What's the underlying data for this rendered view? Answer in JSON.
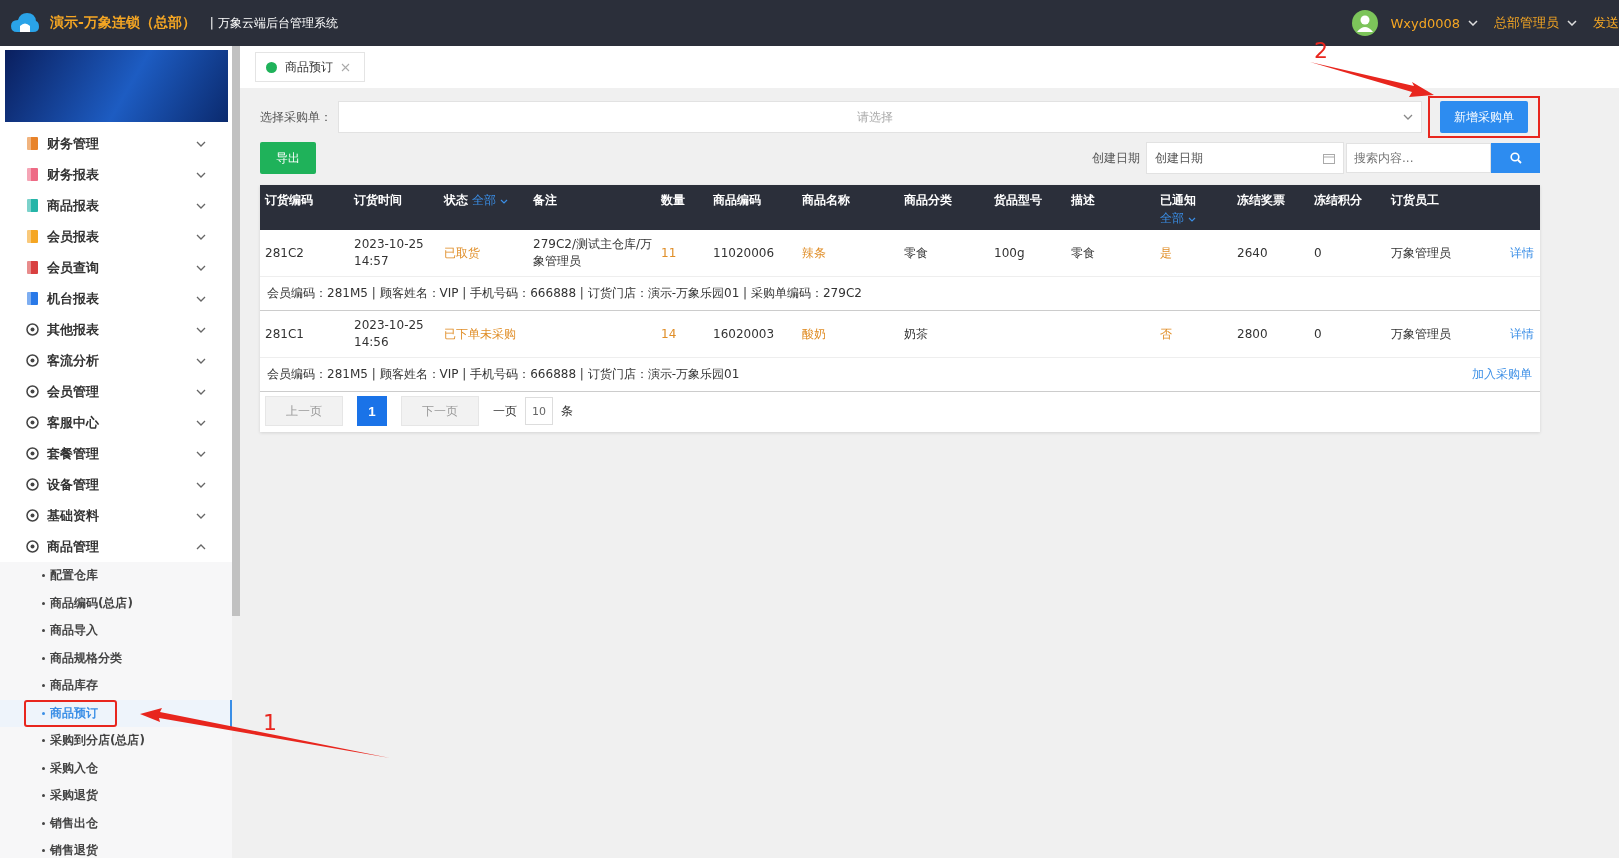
{
  "header": {
    "brand": "演示-万象连锁（总部）",
    "system_title": "| 万象云端后台管理系统",
    "user": "Wxyd0008",
    "role": "总部管理员",
    "extra": "发送"
  },
  "sidebar": {
    "items": [
      {
        "label": "财务管理",
        "expanded": false
      },
      {
        "label": "财务报表",
        "expanded": false
      },
      {
        "label": "商品报表",
        "expanded": false
      },
      {
        "label": "会员报表",
        "expanded": false
      },
      {
        "label": "会员查询",
        "expanded": false
      },
      {
        "label": "机台报表",
        "expanded": false
      },
      {
        "label": "其他报表",
        "expanded": false
      },
      {
        "label": "客流分析",
        "expanded": false
      },
      {
        "label": "会员管理",
        "expanded": false
      },
      {
        "label": "客服中心",
        "expanded": false
      },
      {
        "label": "套餐管理",
        "expanded": false
      },
      {
        "label": "设备管理",
        "expanded": false
      },
      {
        "label": "基础资料",
        "expanded": false
      },
      {
        "label": "商品管理",
        "expanded": true,
        "children": [
          {
            "label": "配置仓库",
            "selected": false,
            "highlighted": false
          },
          {
            "label": "商品编码(总店)",
            "selected": false,
            "highlighted": false
          },
          {
            "label": "商品导入",
            "selected": false,
            "highlighted": false
          },
          {
            "label": "商品规格分类",
            "selected": false,
            "highlighted": false
          },
          {
            "label": "商品库存",
            "selected": false,
            "highlighted": false
          },
          {
            "label": "商品预订",
            "selected": true,
            "highlighted": true
          },
          {
            "label": "采购到分店(总店)",
            "selected": false,
            "highlighted": false
          },
          {
            "label": "采购入仓",
            "selected": false,
            "highlighted": false
          },
          {
            "label": "采购退货",
            "selected": false,
            "highlighted": false
          },
          {
            "label": "销售出仓",
            "selected": false,
            "highlighted": false
          },
          {
            "label": "销售退货",
            "selected": false,
            "highlighted": false
          }
        ]
      }
    ]
  },
  "tabs": [
    {
      "label": "商品预订",
      "selected": true
    }
  ],
  "filters": {
    "order_label": "选择采购单：",
    "order_placeholder": "请选择",
    "new_button": {
      "label": "新增采购单",
      "highlighted": true
    },
    "export_button": "导出",
    "date_label": "创建日期",
    "date_placeholder": "创建日期",
    "search_placeholder": "搜索内容..."
  },
  "table": {
    "columns": [
      {
        "label": "订货编码"
      },
      {
        "label": "订货时间"
      },
      {
        "label": "状态",
        "filter": "全部"
      },
      {
        "label": "备注"
      },
      {
        "label": "数量"
      },
      {
        "label": "商品编码"
      },
      {
        "label": "商品名称"
      },
      {
        "label": "商品分类"
      },
      {
        "label": "货品型号"
      },
      {
        "label": "描述"
      },
      {
        "label": "已通知",
        "filter": "全部"
      },
      {
        "label": "冻结奖票"
      },
      {
        "label": "冻结积分"
      },
      {
        "label": "订货员工"
      }
    ],
    "rows": [
      {
        "cells": [
          "281C2",
          "2023-10-25 14:57",
          "已取货",
          "279C2/测试主仓库/万象管理员",
          "11",
          "11020006",
          "辣条",
          "零食",
          "100g",
          "零食",
          "是",
          "2640",
          "0",
          "万象管理员"
        ],
        "action": "详情",
        "info": "会员编码：281M5 | 顾客姓名：VIP | 手机号码：666888 | 订货门店：演示-万象乐园01 | 采购单编码：279C2"
      },
      {
        "cells": [
          "281C1",
          "2023-10-25 14:56",
          "已下单未采购",
          "",
          "14",
          "16020003",
          "酸奶",
          "奶茶",
          "",
          "",
          "否",
          "2800",
          "0",
          "万象管理员"
        ],
        "action": "详情",
        "info": "会员编码：281M5 | 顾客姓名：VIP | 手机号码：666888 | 订货门店：演示-万象乐园01",
        "info_action": "加入采购单"
      }
    ]
  },
  "pagination": {
    "prev": "上一页",
    "pages": [
      {
        "label": "1",
        "selected": true
      }
    ],
    "next": "下一页",
    "per_page_label": "一页",
    "per_page": "10",
    "unit": "条"
  },
  "annotations": [
    {
      "label": "1"
    },
    {
      "label": "2"
    }
  ]
}
